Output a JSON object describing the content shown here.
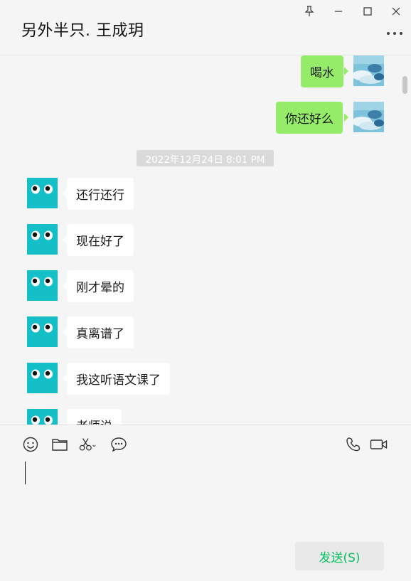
{
  "header": {
    "title": "另外半只. 王成玥"
  },
  "messages": [
    {
      "side": "me",
      "text": "喝水"
    },
    {
      "side": "me",
      "text": "你还好么"
    },
    {
      "side": "other",
      "text": "还行还行"
    },
    {
      "side": "other",
      "text": "现在好了"
    },
    {
      "side": "other",
      "text": "刚才晕的"
    },
    {
      "side": "other",
      "text": "真离谱了"
    },
    {
      "side": "other",
      "text": "我这听语文课了"
    },
    {
      "side": "other",
      "text": "老师说"
    }
  ],
  "timestamp": "2022年12月24日 8:01 PM",
  "toolbar": {
    "left_icons": [
      "emoji-icon",
      "folder-icon",
      "scissors-icon",
      "chat-history-icon"
    ],
    "right_icons": [
      "phone-icon",
      "video-call-icon"
    ]
  },
  "input": {
    "value": ""
  },
  "send_button": {
    "label": "发送(S)"
  },
  "colors": {
    "my_bubble": "#95ec69",
    "other_bubble": "#ffffff",
    "background": "#f5f5f5",
    "send_text": "#07c160",
    "friend_avatar": "#14bfc8"
  }
}
